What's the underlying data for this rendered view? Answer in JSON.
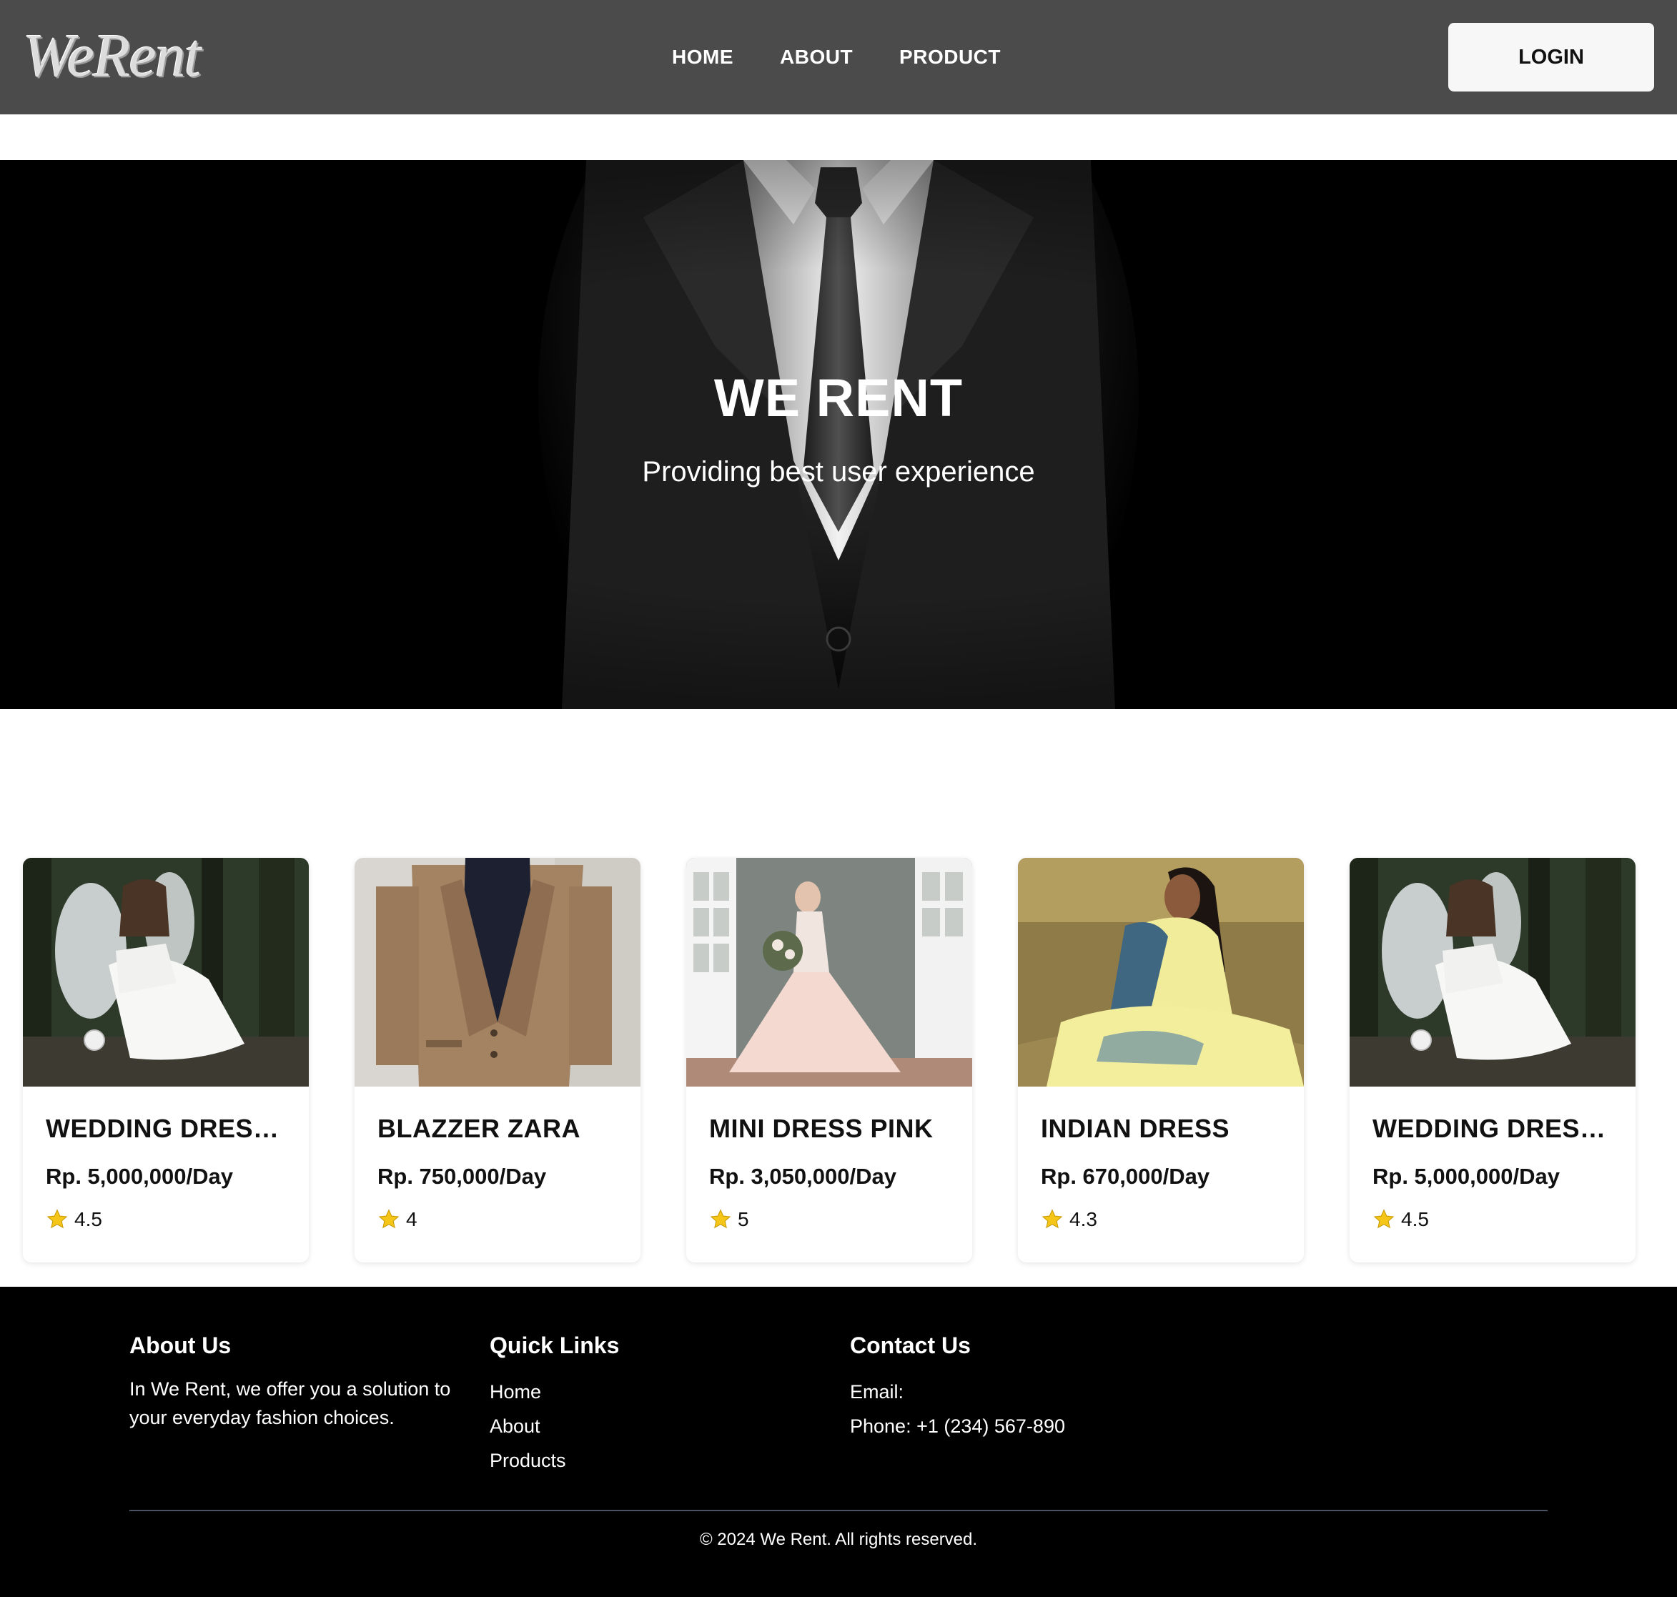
{
  "navbar": {
    "logo_text": "WeRent",
    "links": [
      "HOME",
      "ABOUT",
      "PRODUCT"
    ],
    "login_label": "LOGIN"
  },
  "hero": {
    "title": "WE RENT",
    "subtitle": "Providing best user experience"
  },
  "products": [
    {
      "title": "WEDDING DRESS FAIRY",
      "price": "Rp. 5,000,000/Day",
      "rating": "4.5",
      "image": "fairy-wedding-dress"
    },
    {
      "title": "BLAZZER ZARA",
      "price": "Rp. 750,000/Day",
      "rating": "4",
      "image": "plaid-blazer"
    },
    {
      "title": "MINI DRESS PINK",
      "price": "Rp. 3,050,000/Day",
      "rating": "5",
      "image": "pink-dress"
    },
    {
      "title": "INDIAN DRESS",
      "price": "Rp. 670,000/Day",
      "rating": "4.3",
      "image": "yellow-indian-dress"
    },
    {
      "title": "WEDDING DRESS FAIRY",
      "price": "Rp. 5,000,000/Day",
      "rating": "4.5",
      "image": "fairy-wedding-dress"
    }
  ],
  "footer": {
    "about": {
      "heading": "About Us",
      "text": "In We Rent, we offer you a solution to your everyday fashion choices."
    },
    "quick_links": {
      "heading": "Quick Links",
      "links": [
        "Home",
        "About",
        "Products"
      ]
    },
    "contact": {
      "heading": "Contact Us",
      "email": "Email:",
      "phone": "Phone: +1 (234) 567-890"
    },
    "copyright": "© 2024 We Rent. All rights reserved."
  },
  "colors": {
    "navbar_bg": "#4b4b4b",
    "footer_bg": "#000000",
    "star": "#f5c518"
  }
}
